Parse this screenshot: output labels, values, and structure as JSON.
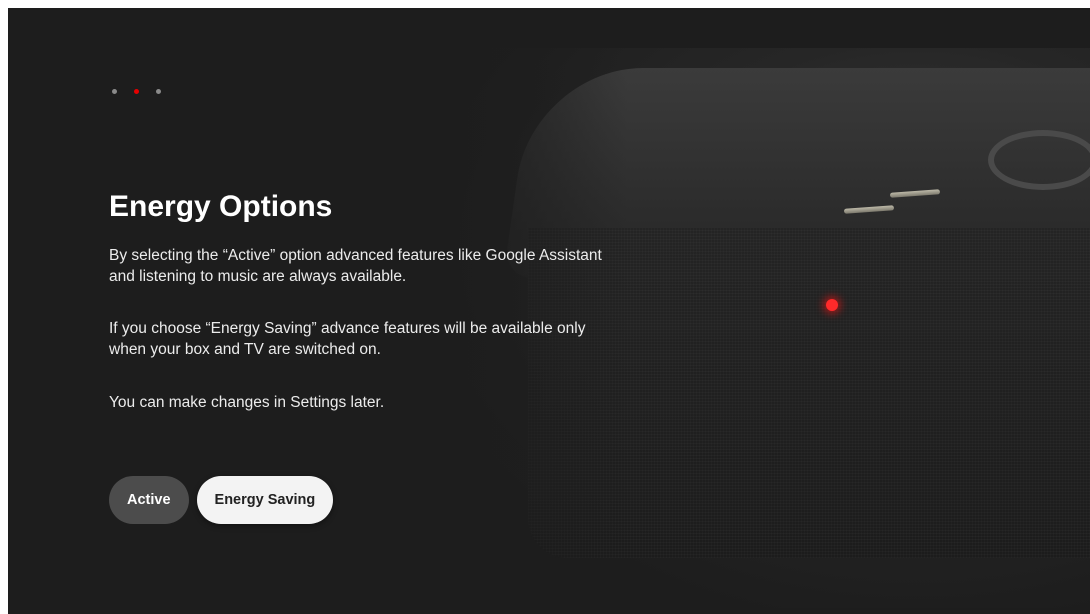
{
  "pager": {
    "count": 3,
    "active_index": 1
  },
  "content": {
    "title": "Energy Options",
    "paragraphs": [
      "By selecting the “Active” option advanced features like Google Assistant and listening to music are always available.",
      "If you choose “Energy Saving” advance features will be available only when your box and TV are switched on.",
      "You can make changes in Settings later."
    ]
  },
  "buttons": {
    "active_label": "Active",
    "energy_saving_label": "Energy Saving",
    "focused": "energy_saving"
  },
  "colors": {
    "background": "#1d1d1d",
    "accent": "#e60000",
    "focused_button": "#f3f3f3",
    "unfocused_button": "#4c4c4c"
  }
}
